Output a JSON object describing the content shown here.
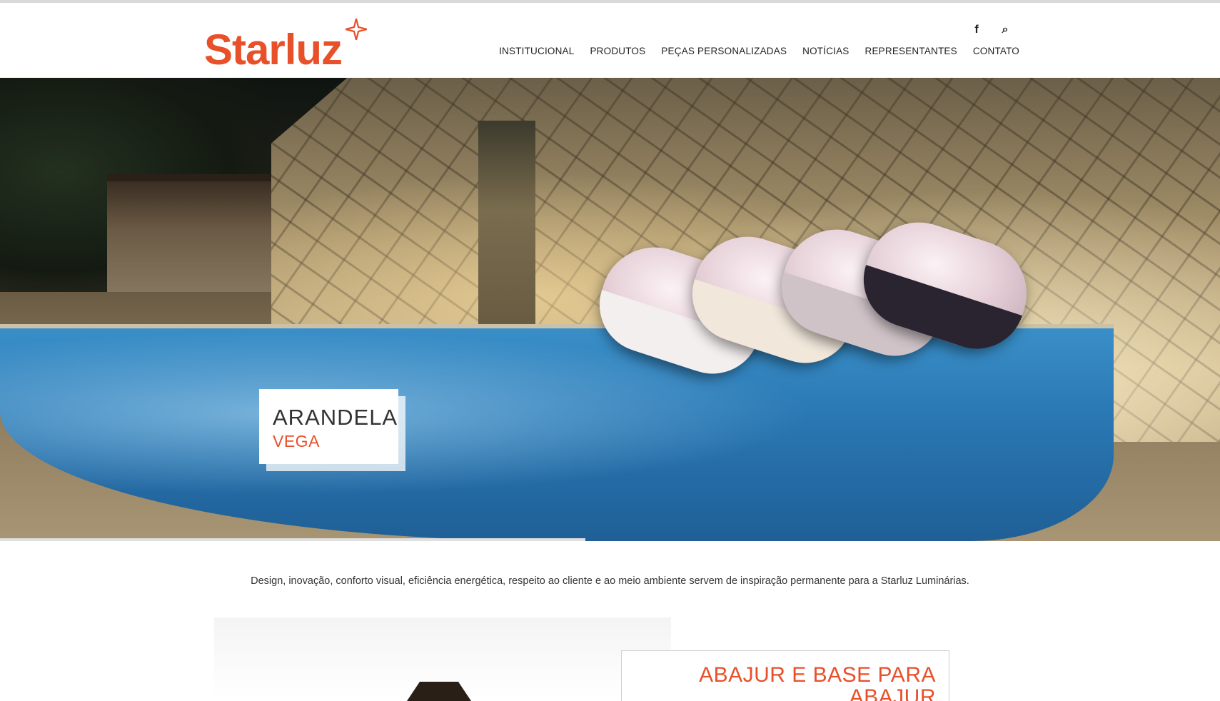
{
  "brand": {
    "name": "Starluz",
    "accent_color": "#e8502a"
  },
  "header": {
    "social": [
      {
        "icon": "facebook-icon",
        "glyph": "f"
      },
      {
        "icon": "search-icon",
        "glyph": "⌕"
      }
    ],
    "nav": [
      "INSTITUCIONAL",
      "PRODUTOS",
      "PEÇAS PERSONALIZADAS",
      "NOTÍCIAS",
      "REPRESENTANTES",
      "CONTATO"
    ]
  },
  "hero": {
    "slide_title": "ARANDELA",
    "slide_subtitle": "VEGA",
    "slider_progress_fraction": 0.48
  },
  "tagline": "Design, inovação, conforto visual, eficiência energética, respeito ao cliente e ao meio ambiente servem de inspiração permanente para a Starluz Luminárias.",
  "feature": {
    "title": "ABAJUR E BASE PARA ABAJUR"
  }
}
